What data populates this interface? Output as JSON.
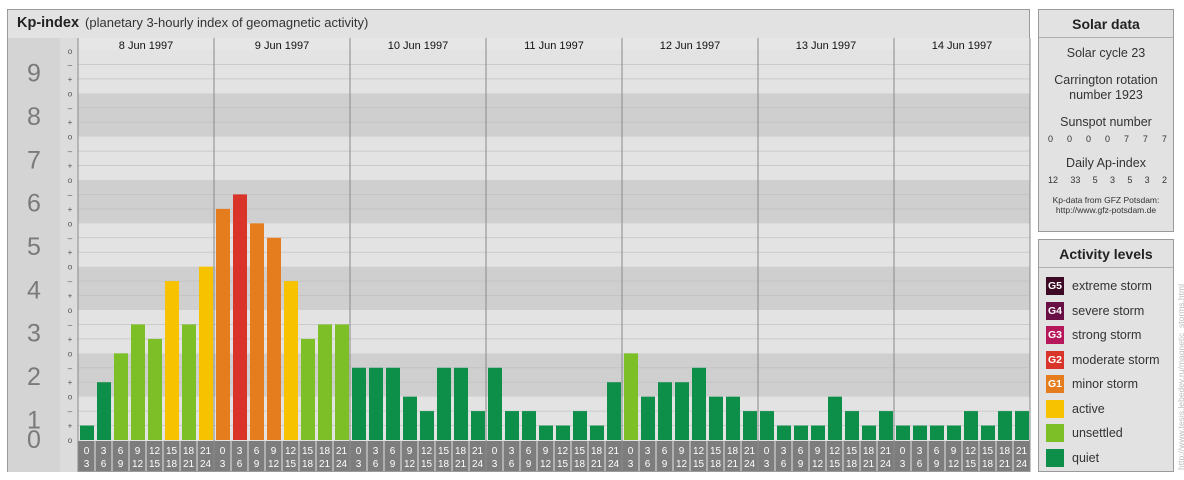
{
  "title": {
    "main": "Kp-index",
    "subtitle": "(planetary 3-hourly index of geomagnetic activity)"
  },
  "colors": {
    "quiet": "#0d8f4a",
    "unsettled": "#7cbf27",
    "active": "#f7c300",
    "minor": "#e57d1e",
    "moderate": "#d9342a",
    "strong": "#b5175a",
    "severe": "#6a0f45",
    "extreme": "#3d0a25"
  },
  "chart_data": {
    "type": "bar",
    "ylim": [
      0,
      9
    ],
    "y_ticks": [
      "0",
      "1",
      "2",
      "3",
      "4",
      "5",
      "6",
      "7",
      "8",
      "9"
    ],
    "minor_ticks": [
      "o",
      "+",
      "–"
    ],
    "days": [
      "8 Jun 1997",
      "9 Jun 1997",
      "10 Jun 1997",
      "11 Jun 1997",
      "12 Jun 1997",
      "13 Jun 1997",
      "14 Jun 1997"
    ],
    "hour_labels": [
      [
        "0",
        "3"
      ],
      [
        "3",
        "6"
      ],
      [
        "6",
        "9"
      ],
      [
        "9",
        "12"
      ],
      [
        "12",
        "15"
      ],
      [
        "15",
        "18"
      ],
      [
        "18",
        "21"
      ],
      [
        "21",
        "24"
      ]
    ],
    "values": [
      [
        0.333,
        1.333,
        2.0,
        2.667,
        2.333,
        3.667,
        2.667,
        4.0
      ],
      [
        5.333,
        5.667,
        5.0,
        4.667,
        3.667,
        2.333,
        2.667,
        2.667
      ],
      [
        1.667,
        1.667,
        1.667,
        1.0,
        0.667,
        1.667,
        1.667,
        0.667
      ],
      [
        1.667,
        0.667,
        0.667,
        0.333,
        0.333,
        0.667,
        0.333,
        1.333
      ],
      [
        2.0,
        1.0,
        1.333,
        1.333,
        1.667,
        1.0,
        1.0,
        0.667
      ],
      [
        0.667,
        0.333,
        0.333,
        0.333,
        1.0,
        0.667,
        0.333,
        0.667
      ],
      [
        0.333,
        0.333,
        0.333,
        0.333,
        0.667,
        0.333,
        0.667,
        0.667
      ]
    ]
  },
  "solar": {
    "title": "Solar data",
    "cycle": "Solar cycle 23",
    "carrington_line1": "Carrington rotation",
    "carrington_line2": "number 1923",
    "sunspot_label": "Sunspot number",
    "sunspot_values": [
      "0",
      "0",
      "0",
      "0",
      "7",
      "7",
      "7"
    ],
    "ap_label": "Daily Ap-index",
    "ap_values": [
      "12",
      "33",
      "5",
      "3",
      "5",
      "3",
      "2"
    ],
    "credit_line1": "Kp-data from GFZ Potsdam:",
    "credit_line2": "http://www.gfz-potsdam.de"
  },
  "activity": {
    "title": "Activity levels",
    "items": [
      {
        "code": "G5",
        "label": "extreme storm",
        "color": "#3d0a25"
      },
      {
        "code": "G4",
        "label": "severe storm",
        "color": "#6a0f45"
      },
      {
        "code": "G3",
        "label": "strong storm",
        "color": "#b5175a"
      },
      {
        "code": "G2",
        "label": "moderate storm",
        "color": "#d9342a"
      },
      {
        "code": "G1",
        "label": "minor storm",
        "color": "#e57d1e"
      },
      {
        "code": "",
        "label": "active",
        "color": "#f7c300"
      },
      {
        "code": "",
        "label": "unsettled",
        "color": "#7cbf27"
      },
      {
        "code": "",
        "label": "quiet",
        "color": "#0d8f4a"
      }
    ]
  },
  "watermark": "http://www.tesis.lebedev.ru/magnetic_storms.html"
}
